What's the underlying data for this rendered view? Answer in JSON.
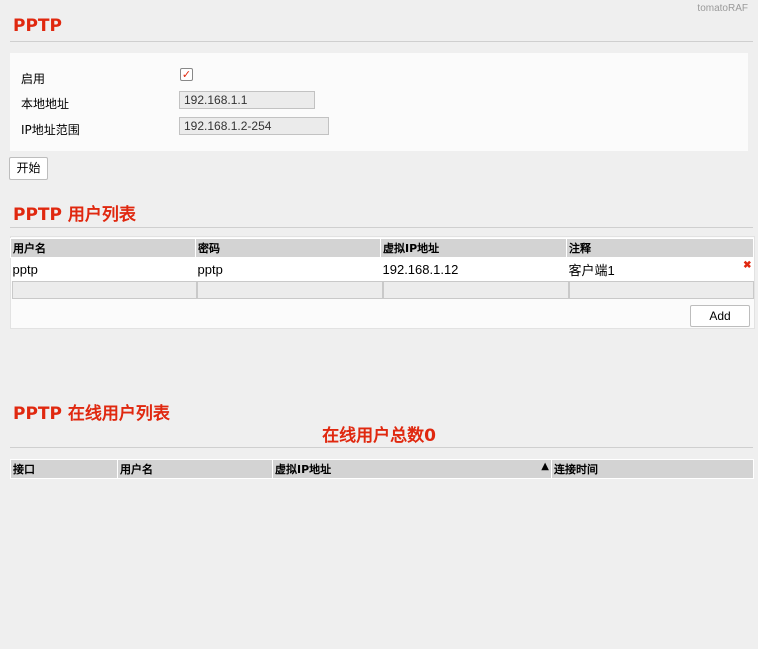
{
  "brand": "tomatoRAF",
  "pptp": {
    "title": "PPTP",
    "enable_label": "启用",
    "enable_checked": true,
    "local_address_label": "本地地址",
    "local_address_value": "192.168.1.1",
    "ip_range_label": "IP地址范围",
    "ip_range_value": "192.168.1.2-254",
    "start_button": "开始"
  },
  "user_list": {
    "title": "PPTP 用户列表",
    "columns": [
      "用户名",
      "密码",
      "虚拟IP地址",
      "注释"
    ],
    "rows": [
      {
        "username": "pptp",
        "password": "pptp",
        "virtual_ip": "192.168.1.12",
        "comment": "客户端1"
      }
    ],
    "delete_icon": "✖",
    "add_button": "Add"
  },
  "online_list": {
    "title": "PPTP 在线用户列表",
    "count_text": "在线用户总数0",
    "columns": [
      "接口",
      "用户名",
      "虚拟IP地址",
      "连接时间"
    ],
    "sort_indicator": "▲"
  }
}
